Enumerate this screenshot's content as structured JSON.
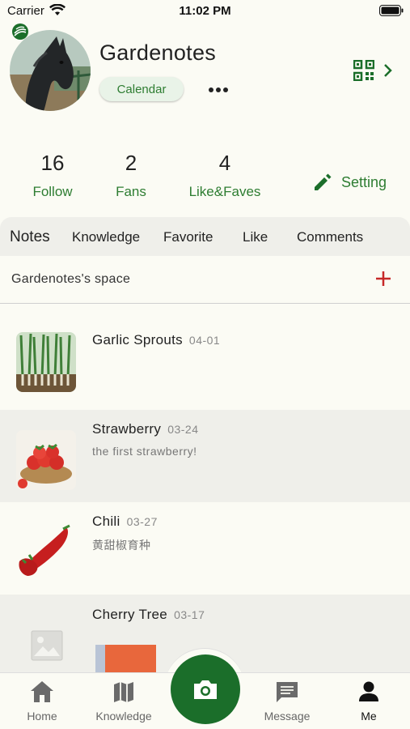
{
  "status_bar": {
    "carrier": "Carrier",
    "time": "11:02 PM"
  },
  "profile": {
    "username": "Gardenotes",
    "calendar_label": "Calendar"
  },
  "stats": [
    {
      "count": "16",
      "label": "Follow"
    },
    {
      "count": "2",
      "label": "Fans"
    },
    {
      "count": "4",
      "label": "Like&Faves"
    }
  ],
  "setting_label": "Setting",
  "tabs": [
    "Notes",
    "Knowledge",
    "Favorite",
    "Like",
    "Comments"
  ],
  "space_label": "Gardenotes's space",
  "notes": [
    {
      "title": "Garlic Sprouts",
      "date": "04-01",
      "subtitle": ""
    },
    {
      "title": "Strawberry",
      "date": "03-24",
      "subtitle": "the first strawberry!"
    },
    {
      "title": "Chili",
      "date": "03-27",
      "subtitle": "黄甜椒育种"
    },
    {
      "title": "Cherry Tree",
      "date": "03-17",
      "subtitle": ""
    }
  ],
  "bottom_nav": [
    {
      "label": "Home",
      "icon": "home-icon"
    },
    {
      "label": "Knowledge",
      "icon": "map-icon"
    },
    {
      "label": "Message",
      "icon": "message-icon"
    },
    {
      "label": "Me",
      "icon": "person-icon"
    }
  ],
  "colors": {
    "accent": "#2e7d32",
    "camera": "#1b6e2a",
    "plus": "#c62828"
  }
}
